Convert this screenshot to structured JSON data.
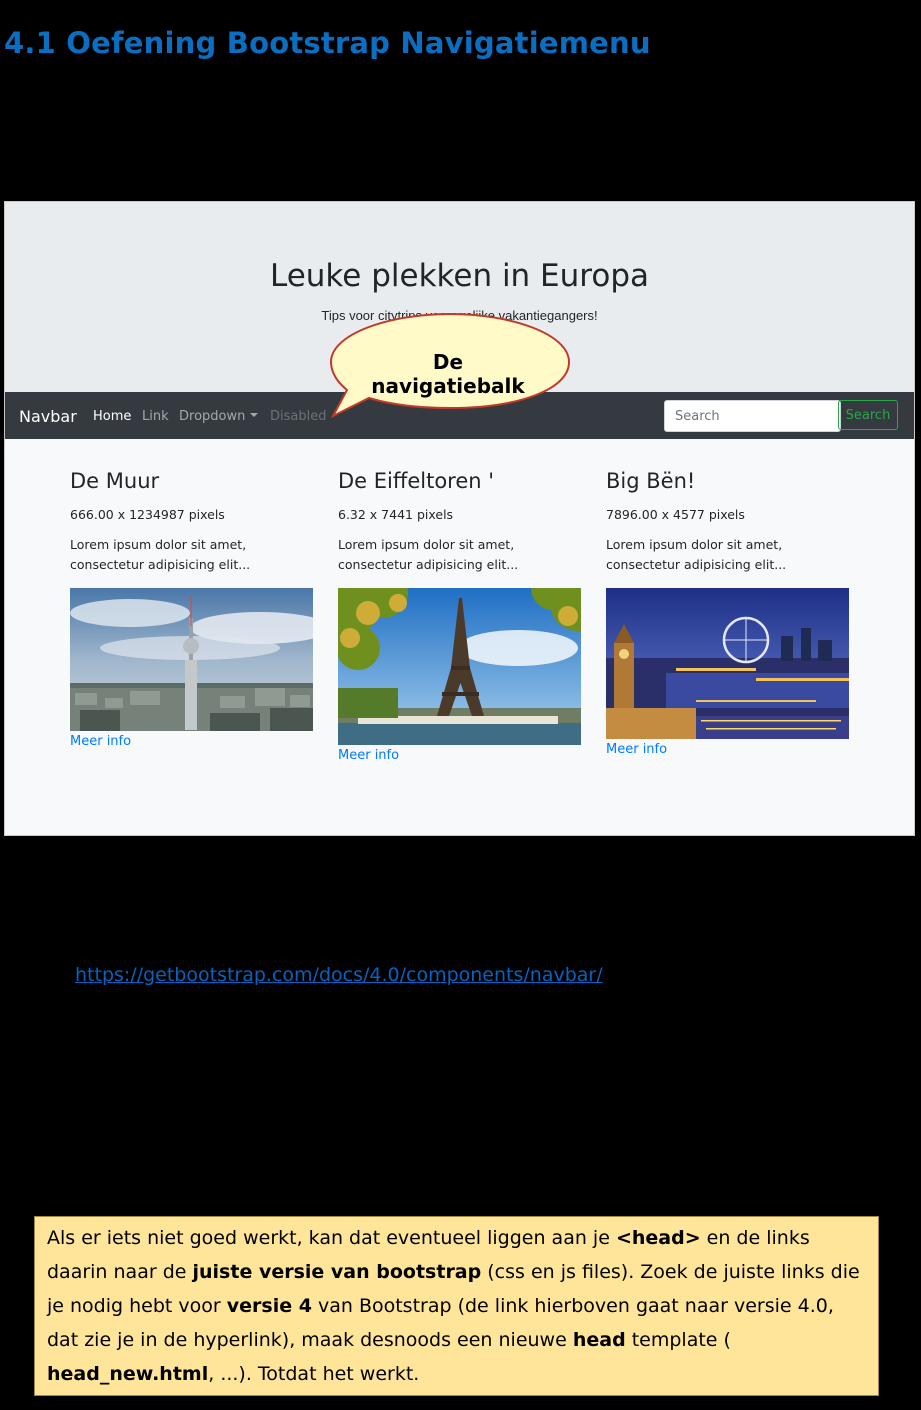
{
  "heading": "4.1 Oefening Bootstrap Navigatiemenu",
  "screenshot": {
    "jumbotron": {
      "title": "Leuke plekken in Europa",
      "subtitle": "Tips voor citytrips voor vrolijke vakantiegangers!"
    },
    "navbar": {
      "brand": "Navbar",
      "links": [
        "Home",
        "Link",
        "Dropdown",
        "Disabled"
      ],
      "search_placeholder": "Search",
      "search_button": "Search"
    },
    "cards": [
      {
        "title": "De Muur",
        "dims": "666.00 x 1234987 pixels",
        "text": "Lorem ipsum dolor sit amet, consectetur adipisicing elit...",
        "link": "Meer info"
      },
      {
        "title": "De Eiffeltoren '",
        "dims": "6.32 x 7441 pixels",
        "text": "Lorem ipsum dolor sit amet, consectetur adipisicing elit...",
        "link": "Meer info"
      },
      {
        "title": "Big Bën!",
        "dims": "7896.00 x 4577 pixels",
        "text": "Lorem ipsum dolor sit amet, consectetur adipisicing elit...",
        "link": "Meer info"
      }
    ],
    "callout": "De navigatiebalk"
  },
  "url": "https://getbootstrap.com/docs/4.0/components/navbar/",
  "note": {
    "p1": "Als er iets niet goed werkt, kan dat eventueel liggen aan je ",
    "b1": "<head>",
    "p2": " en de links daarin naar de ",
    "b2": "juiste versie van bootstrap",
    "p3": " (css en js files). Zoek de juiste links die je nodig hebt voor ",
    "b3": "versie 4",
    "p4": " van Bootstrap (de link hierboven gaat naar versie 4.0, dat zie je in de hyperlink), maak desnoods een nieuwe ",
    "b4": "head",
    "p5": " template ( ",
    "b5": "head_new.html",
    "p6": ", ...). Totdat het werkt."
  },
  "colors": {
    "heading": "#0a6fc2",
    "navbar_bg": "#343a40",
    "jumbotron_bg": "#e9ecef",
    "link_blue": "#007bff",
    "search_green": "#28a745",
    "callout_fill": "#fffac8",
    "callout_border": "#c0392b",
    "note_bg": "#ffe599"
  }
}
